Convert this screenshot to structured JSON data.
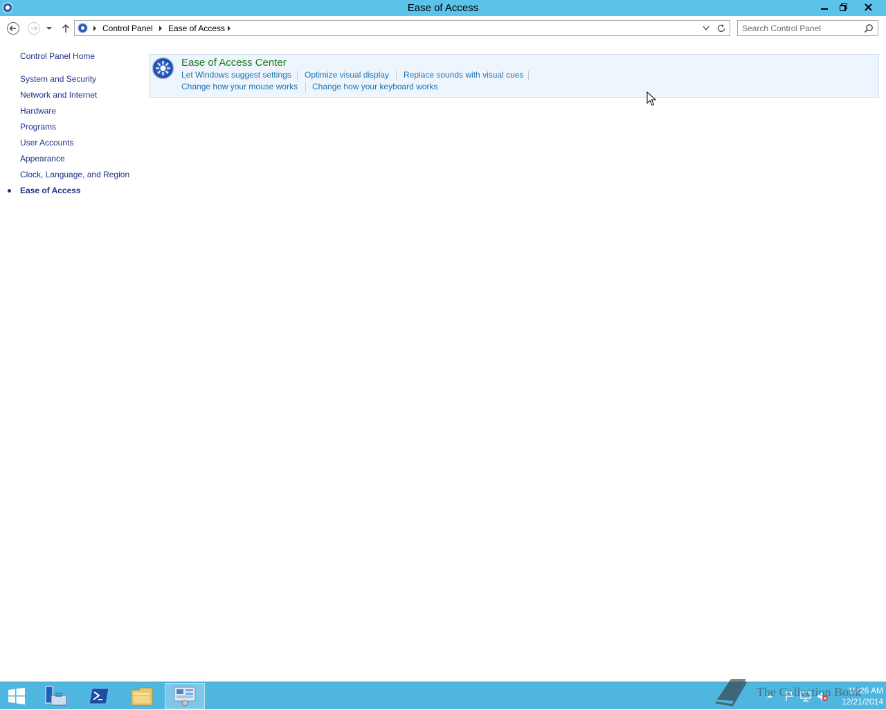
{
  "window": {
    "title": "Ease of Access"
  },
  "address": {
    "crumbs": [
      "Control Panel",
      "Ease of Access"
    ]
  },
  "search": {
    "placeholder": "Search Control Panel"
  },
  "sidebar": {
    "home": "Control Panel Home",
    "items": [
      {
        "label": "System and Security"
      },
      {
        "label": "Network and Internet"
      },
      {
        "label": "Hardware"
      },
      {
        "label": "Programs"
      },
      {
        "label": "User Accounts"
      },
      {
        "label": "Appearance"
      },
      {
        "label": "Clock, Language, and Region"
      },
      {
        "label": "Ease of Access",
        "active": true
      }
    ]
  },
  "main": {
    "section_title": "Ease of Access Center",
    "links_row1": [
      "Let Windows suggest settings",
      "Optimize visual display",
      "Replace sounds with visual cues"
    ],
    "links_row2": [
      "Change how your mouse works",
      "Change how your keyboard works"
    ]
  },
  "taskbar": {
    "apps": [
      "start-button",
      "server-manager",
      "powershell",
      "file-explorer",
      "control-panel"
    ],
    "time": "10:26 AM",
    "date": "12/21/2014"
  },
  "watermark": {
    "text": "The Collection Book"
  },
  "colors": {
    "titlebar": "#5bc2ea",
    "taskbar": "#4fb6e0",
    "link": "#1e73b5",
    "nav_link": "#1e3287",
    "section_title": "#1a7a1a",
    "panel_bg": "#eef5fc"
  }
}
